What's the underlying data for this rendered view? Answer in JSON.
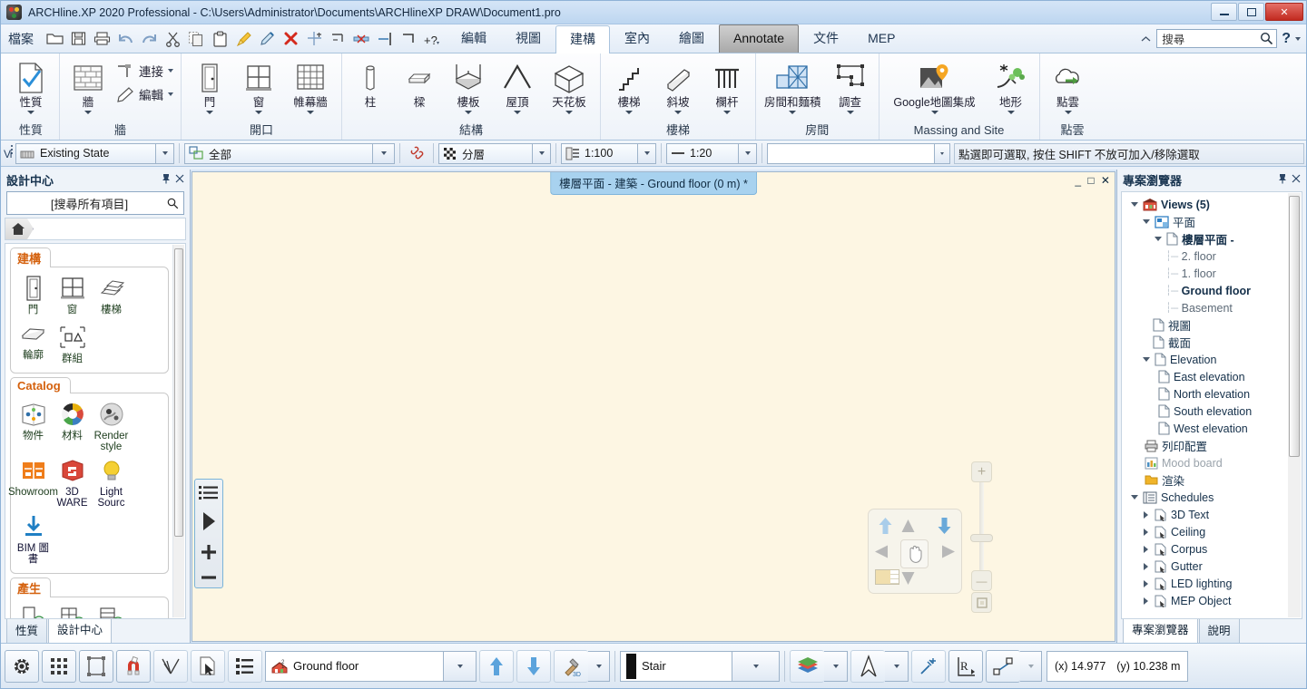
{
  "window": {
    "title": "ARCHline.XP 2020  Professional - C:\\Users\\Administrator\\Documents\\ARCHlineXP DRAW\\Document1.pro",
    "minimize": "minimize-icon",
    "maximize": "maximize-icon",
    "close": "✕"
  },
  "quick_access": {
    "file_label": "檔案",
    "buttons": [
      {
        "name": "open-icon"
      },
      {
        "name": "save-icon"
      },
      {
        "name": "print-icon"
      },
      {
        "name": "undo-icon"
      },
      {
        "name": "redo-icon"
      },
      {
        "name": "cut-icon"
      },
      {
        "name": "copy-icon"
      },
      {
        "name": "paste-icon"
      },
      {
        "name": "paintbrush-icon"
      },
      {
        "name": "pen-icon"
      },
      {
        "name": "delete-icon"
      },
      {
        "name": "trim-icon"
      },
      {
        "name": "extend-icon"
      },
      {
        "name": "break-icon"
      },
      {
        "name": "divide-icon"
      },
      {
        "name": "corner-icon"
      },
      {
        "name": "customize-icon"
      }
    ]
  },
  "ribbon": {
    "tabs": [
      {
        "label": "編輯",
        "state": "normal"
      },
      {
        "label": "視圖",
        "state": "normal"
      },
      {
        "label": "建構",
        "state": "active"
      },
      {
        "label": "室內",
        "state": "normal"
      },
      {
        "label": "繪圖",
        "state": "normal"
      },
      {
        "label": "Annotate",
        "state": "selected"
      },
      {
        "label": "文件",
        "state": "normal"
      },
      {
        "label": "MEP",
        "state": "normal"
      }
    ],
    "collapse_icon": "chevron-up-icon",
    "search": {
      "placeholder": "搜尋",
      "value": "搜尋",
      "icon": "search-icon"
    },
    "help": "?",
    "groups": [
      {
        "name": "性質",
        "big": [
          {
            "label": "性質",
            "icon": "properties-icon",
            "caret": true
          }
        ],
        "small": []
      },
      {
        "name": "牆",
        "big": [
          {
            "label": "牆",
            "icon": "wall-icon",
            "caret": true
          }
        ],
        "small": [
          {
            "label": "連接",
            "icon": "wall-connect-icon",
            "caret": true
          },
          {
            "label": "編輯",
            "icon": "wall-edit-icon",
            "caret": true
          }
        ]
      },
      {
        "name": "開口",
        "big": [
          {
            "label": "門",
            "icon": "door-icon",
            "caret": true
          },
          {
            "label": "窗",
            "icon": "window-icon",
            "caret": true
          },
          {
            "label": "帷幕牆",
            "icon": "curtain-wall-icon",
            "caret": true
          }
        ],
        "small": []
      },
      {
        "name": "結構",
        "big": [
          {
            "label": "柱",
            "icon": "column-icon",
            "caret": false
          },
          {
            "label": "樑",
            "icon": "beam-icon",
            "caret": false
          },
          {
            "label": "樓板",
            "icon": "slab-icon",
            "caret": true
          },
          {
            "label": "屋頂",
            "icon": "roof-icon",
            "caret": true
          },
          {
            "label": "天花板",
            "icon": "ceiling-icon",
            "caret": true
          }
        ],
        "small": []
      },
      {
        "name": "樓梯",
        "big": [
          {
            "label": "樓梯",
            "icon": "stair-icon",
            "caret": true
          },
          {
            "label": "斜坡",
            "icon": "ramp-icon",
            "caret": true
          },
          {
            "label": "欄杆",
            "icon": "railing-icon",
            "caret": true
          }
        ],
        "small": []
      },
      {
        "name": "房間",
        "big": [
          {
            "label": "房間和麵積",
            "icon": "room-area-icon",
            "caret": true
          },
          {
            "label": "調查",
            "icon": "survey-icon",
            "caret": true
          }
        ],
        "small": []
      },
      {
        "name": "Massing and Site",
        "big": [
          {
            "label": "Google地圖集成",
            "icon": "google-maps-icon",
            "caret": true
          },
          {
            "label": "地形",
            "icon": "terrain-icon",
            "caret": true
          }
        ],
        "small": []
      },
      {
        "name": "點雲",
        "big": [
          {
            "label": "點雲",
            "icon": "point-cloud-icon",
            "caret": true
          }
        ],
        "small": []
      }
    ]
  },
  "options_bar": {
    "grip": "vi-grip",
    "status_combo": {
      "value": "Existing State",
      "icon": "state-icon"
    },
    "layer_combo": {
      "value": "全部",
      "icon": "all-layers-icon"
    },
    "link_icon": "link-icon",
    "layer_group_combo": {
      "value": "分層",
      "icon": "layers-icon"
    },
    "scale_combo": {
      "value": "1:100",
      "icon": "scale-icon"
    },
    "detail_combo": {
      "value": "1:20",
      "icon": "line-icon"
    },
    "empty_combo": {
      "value": ""
    },
    "hint": "點選即可選取, 按住 SHIFT 不放可加入/移除選取"
  },
  "left_panel": {
    "title": "設計中心",
    "pin_icon": "pin-icon",
    "close_icon": "close-icon",
    "search": {
      "placeholder": "[搜尋所有項目]",
      "value": "[搜尋所有項目]",
      "icon": "search-icon"
    },
    "breadcrumb_home": "home-icon",
    "categories": [
      {
        "name": "建構",
        "items": [
          {
            "label": "門",
            "icon": "door-icon"
          },
          {
            "label": "窗",
            "icon": "window-icon"
          },
          {
            "label": "樓梯",
            "icon": "stair-icon"
          },
          {
            "label": "輪廓",
            "icon": "profile-icon"
          },
          {
            "label": "群組",
            "icon": "group-icon"
          }
        ]
      },
      {
        "name": "Catalog",
        "items": [
          {
            "label": "物件",
            "icon": "object-icon"
          },
          {
            "label": "材料",
            "icon": "material-icon"
          },
          {
            "label": "Render style",
            "icon": "render-style-icon"
          },
          {
            "label": "Showroom",
            "icon": "showroom-icon"
          },
          {
            "label": "3D WARE",
            "icon": "3d-warehouse-icon"
          },
          {
            "label": "Light Sourc",
            "icon": "light-source-icon"
          },
          {
            "label": "BIM 圖書",
            "icon": "bim-library-icon"
          }
        ]
      },
      {
        "name": "產生",
        "items": [
          {
            "label": "",
            "icon": "add-door-icon"
          },
          {
            "label": "",
            "icon": "add-window-icon"
          },
          {
            "label": "",
            "icon": "add-corpus-icon"
          },
          {
            "label": "",
            "icon": "add-material-icon"
          }
        ]
      }
    ],
    "tabs": [
      {
        "label": "性質",
        "active": false
      },
      {
        "label": "設計中心",
        "active": true
      }
    ]
  },
  "canvas": {
    "doc_tab": "樓層平面 - 建築 - Ground floor (0 m) *",
    "window_controls": "_ □ ✕",
    "left_toolbar": [
      {
        "name": "list-icon"
      },
      {
        "name": "play-icon"
      },
      {
        "name": "plus-icon"
      },
      {
        "name": "minus-icon"
      }
    ],
    "nav_pad": {
      "up_big": "pan-up-icon",
      "up_small": "tilt-up-icon",
      "down_big": "pan-down-icon",
      "left": "rotate-left-icon",
      "right": "rotate-right-icon",
      "hand": "pan-hand-icon",
      "down_small": "tilt-down-icon",
      "swatch": "color-swatch-icon"
    },
    "zoom_slider": {
      "plus": "+",
      "minus": "—",
      "fit": "zoom-fit-icon"
    }
  },
  "right_panel": {
    "title": "專案瀏覽器",
    "pin_icon": "pin-icon",
    "close_icon": "close-icon",
    "tree": [
      {
        "label": "Views (5)",
        "depth": 0,
        "arrow": "down",
        "icon": "views-icon",
        "style": "bold"
      },
      {
        "label": "平面",
        "depth": 1,
        "arrow": "down",
        "icon": "plan-icon",
        "style": "normal"
      },
      {
        "label": "樓層平面 -",
        "depth": 2,
        "arrow": "down",
        "icon": "doc-icon",
        "style": "bold"
      },
      {
        "label": "2. floor",
        "depth": 3,
        "arrow": "none",
        "icon": "dash",
        "style": "grey"
      },
      {
        "label": "1. floor",
        "depth": 3,
        "arrow": "none",
        "icon": "dash",
        "style": "grey"
      },
      {
        "label": "Ground floor",
        "depth": 3,
        "arrow": "none",
        "icon": "dash",
        "style": "bold"
      },
      {
        "label": "Basement",
        "depth": 3,
        "arrow": "none",
        "icon": "dash",
        "style": "grey"
      },
      {
        "label": "視圖",
        "depth": 2,
        "arrow": "none",
        "icon": "doc-icon",
        "style": "normal"
      },
      {
        "label": "截面",
        "depth": 2,
        "arrow": "none",
        "icon": "doc-icon",
        "style": "normal"
      },
      {
        "label": "Elevation",
        "depth": 1,
        "arrow": "down",
        "icon": "doc-icon",
        "style": "normal"
      },
      {
        "label": "East elevation",
        "depth": 2,
        "arrow": "none",
        "icon": "doc-icon",
        "style": "normal"
      },
      {
        "label": "North elevation",
        "depth": 2,
        "arrow": "none",
        "icon": "doc-icon",
        "style": "normal"
      },
      {
        "label": "South elevation",
        "depth": 2,
        "arrow": "none",
        "icon": "doc-icon",
        "style": "normal"
      },
      {
        "label": "West elevation",
        "depth": 2,
        "arrow": "none",
        "icon": "doc-icon",
        "style": "normal"
      },
      {
        "label": "列印配置",
        "depth": 1,
        "arrow": "none",
        "icon": "print-layout-icon",
        "style": "normal"
      },
      {
        "label": "Mood board",
        "depth": 1,
        "arrow": "none",
        "icon": "mood-board-icon",
        "style": "dim"
      },
      {
        "label": "渲染",
        "depth": 1,
        "arrow": "none",
        "icon": "folder-icon",
        "style": "normal"
      },
      {
        "label": "Schedules",
        "depth": 0,
        "arrow": "down",
        "icon": "schedules-icon",
        "style": "normal"
      },
      {
        "label": "3D Text",
        "depth": 1,
        "arrow": "right",
        "icon": "schedule-item-icon",
        "style": "normal"
      },
      {
        "label": "Ceiling",
        "depth": 1,
        "arrow": "right",
        "icon": "schedule-item-icon",
        "style": "normal"
      },
      {
        "label": "Corpus",
        "depth": 1,
        "arrow": "right",
        "icon": "schedule-item-icon",
        "style": "normal"
      },
      {
        "label": "Gutter",
        "depth": 1,
        "arrow": "right",
        "icon": "schedule-item-icon",
        "style": "normal"
      },
      {
        "label": "LED lighting",
        "depth": 1,
        "arrow": "right",
        "icon": "schedule-item-icon",
        "style": "normal"
      },
      {
        "label": "MEP Object",
        "depth": 1,
        "arrow": "right",
        "icon": "schedule-item-icon",
        "style": "normal"
      }
    ],
    "tabs": [
      {
        "label": "專案瀏覽器",
        "active": true
      },
      {
        "label": "說明",
        "active": false
      }
    ]
  },
  "status_bar": {
    "buttons": [
      {
        "name": "settings-gear-icon"
      },
      {
        "name": "grid-icon"
      },
      {
        "name": "bounding-box-icon"
      },
      {
        "name": "magnet-snap-icon"
      },
      {
        "name": "angle-snap-icon"
      },
      {
        "name": "select-cursor-icon"
      },
      {
        "name": "layer-list-icon"
      }
    ],
    "floor_combo": {
      "value": "Ground floor",
      "icon": "floor-icon"
    },
    "up_icon": "arrow-up-icon",
    "down_icon": "arrow-down-icon",
    "hammer_icon": "3d-hammer-icon",
    "linetype_combo": {
      "value": "Stair",
      "icon": "line-swatch-icon"
    },
    "material_icon": "material-stack-icon",
    "compass_icon": "north-arrow-icon",
    "snap_icon": "snap-point-icon",
    "ucs_icon": "ucs-R-icon",
    "dim_icon": "dimension-icon",
    "coordinates": {
      "x_label": "(x) 14.977",
      "y_label": "(y) 10.238 m"
    }
  },
  "colors": {
    "canvas": "#fdf6e3",
    "accent": "#a8d2ef",
    "titlebar": "#cfe2f5",
    "category_heading": "#d4600c"
  }
}
